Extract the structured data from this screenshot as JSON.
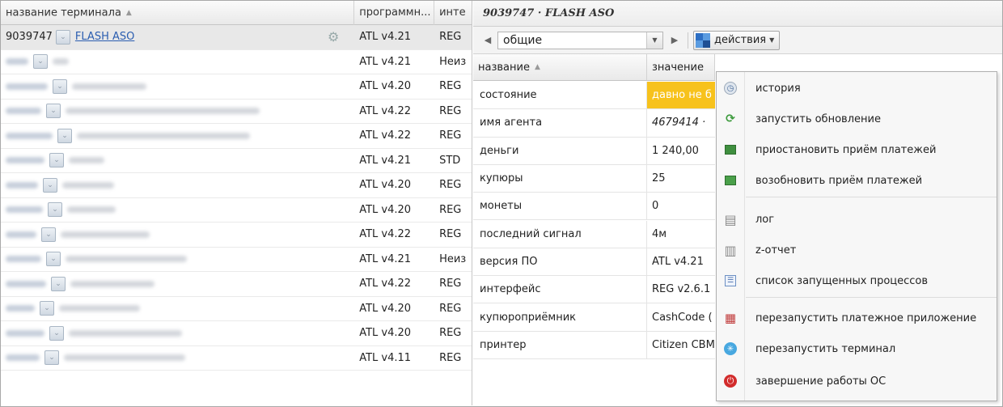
{
  "left_grid": {
    "columns": [
      "название терминала",
      "программн...",
      "инте"
    ],
    "selected_row": {
      "id": "9039747",
      "name": "FLASH ASO",
      "program": "ATL v4.21",
      "interface": "REG"
    },
    "rows": [
      {
        "program": "ATL v4.21",
        "interface": "Неиз"
      },
      {
        "program": "ATL v4.20",
        "interface": "REG"
      },
      {
        "program": "ATL v4.22",
        "interface": "REG"
      },
      {
        "program": "ATL v4.22",
        "interface": "REG"
      },
      {
        "program": "ATL v4.21",
        "interface": "STD"
      },
      {
        "program": "ATL v4.20",
        "interface": "REG"
      },
      {
        "program": "ATL v4.20",
        "interface": "REG"
      },
      {
        "program": "ATL v4.22",
        "interface": "REG"
      },
      {
        "program": "ATL v4.21",
        "interface": "Неиз"
      },
      {
        "program": "ATL v4.22",
        "interface": "REG"
      },
      {
        "program": "ATL v4.20",
        "interface": "REG"
      },
      {
        "program": "ATL v4.20",
        "interface": "REG"
      },
      {
        "program": "ATL v4.11",
        "interface": "REG"
      }
    ]
  },
  "detail": {
    "title_id": "9039747",
    "title_sep": " · ",
    "title_name": "FLASH ASO",
    "section_combo": "общие",
    "actions_label": "действия",
    "columns": [
      "название",
      "значение"
    ],
    "props": [
      {
        "key": "состояние",
        "value": "давно не б"
      },
      {
        "key": "имя агента",
        "value": "4679414 · "
      },
      {
        "key": "деньги",
        "value": "1 240,00"
      },
      {
        "key": "купюры",
        "value": "25"
      },
      {
        "key": "монеты",
        "value": "0"
      },
      {
        "key": "последний сигнал",
        "value": "4м"
      },
      {
        "key": "версия ПО",
        "value": "ATL v4.21"
      },
      {
        "key": "интерфейс",
        "value": "REG v2.6.1"
      },
      {
        "key": "купюроприёмник",
        "value": "CashCode ("
      },
      {
        "key": "принтер",
        "value": "Citizen CBM"
      }
    ]
  },
  "menu": {
    "items": [
      {
        "label": "история",
        "icon": "history-icon"
      },
      {
        "label": "запустить обновление",
        "icon": "update-icon"
      },
      {
        "label": "приостановить приём платежей",
        "icon": "pause-payments-icon"
      },
      {
        "label": "возобновить приём платежей",
        "icon": "resume-payments-icon"
      },
      {
        "label": "лог",
        "icon": "log-icon"
      },
      {
        "label": "z-отчет",
        "icon": "z-report-icon"
      },
      {
        "label": "список запущенных процессов",
        "icon": "process-list-icon"
      },
      {
        "label": "перезапустить платежное приложение",
        "icon": "restart-app-icon"
      },
      {
        "label": "перезапустить терминал",
        "icon": "restart-terminal-icon"
      },
      {
        "label": "завершение работы ОС",
        "icon": "shutdown-icon"
      }
    ]
  },
  "colors": {
    "warning": "#f7c21c",
    "link": "#2a5db0",
    "shutdown": "#d22c2c"
  }
}
